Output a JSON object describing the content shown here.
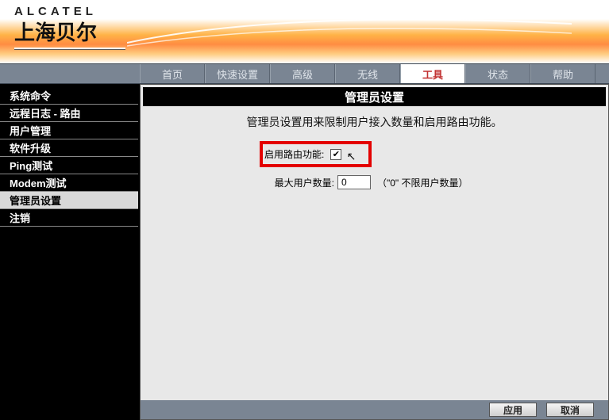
{
  "logo": {
    "brand": "ALCATEL",
    "sub": "上海贝尔"
  },
  "nav": {
    "items": [
      {
        "label": "首页"
      },
      {
        "label": "快速设置"
      },
      {
        "label": "高级"
      },
      {
        "label": "无线"
      },
      {
        "label": "工具",
        "active": true
      },
      {
        "label": "状态"
      },
      {
        "label": "帮助"
      }
    ]
  },
  "sidebar": {
    "items": [
      {
        "label": "系统命令"
      },
      {
        "label": "远程日志 - 路由"
      },
      {
        "label": "用户管理"
      },
      {
        "label": "软件升级"
      },
      {
        "label": "Ping测试"
      },
      {
        "label": "Modem测试"
      },
      {
        "label": "管理员设置",
        "active": true
      },
      {
        "label": "注销"
      }
    ]
  },
  "panel": {
    "title": "管理员设置",
    "desc": "管理员设置用来限制用户接入数量和启用路由功能。",
    "enable_route_label": "启用路由功能:",
    "enable_route_checked": "✔",
    "max_users_label": "最大用户数量:",
    "max_users_value": "0",
    "max_users_hint": "（\"0\" 不限用户数量）"
  },
  "buttons": {
    "apply": "应用",
    "cancel": "取消"
  }
}
